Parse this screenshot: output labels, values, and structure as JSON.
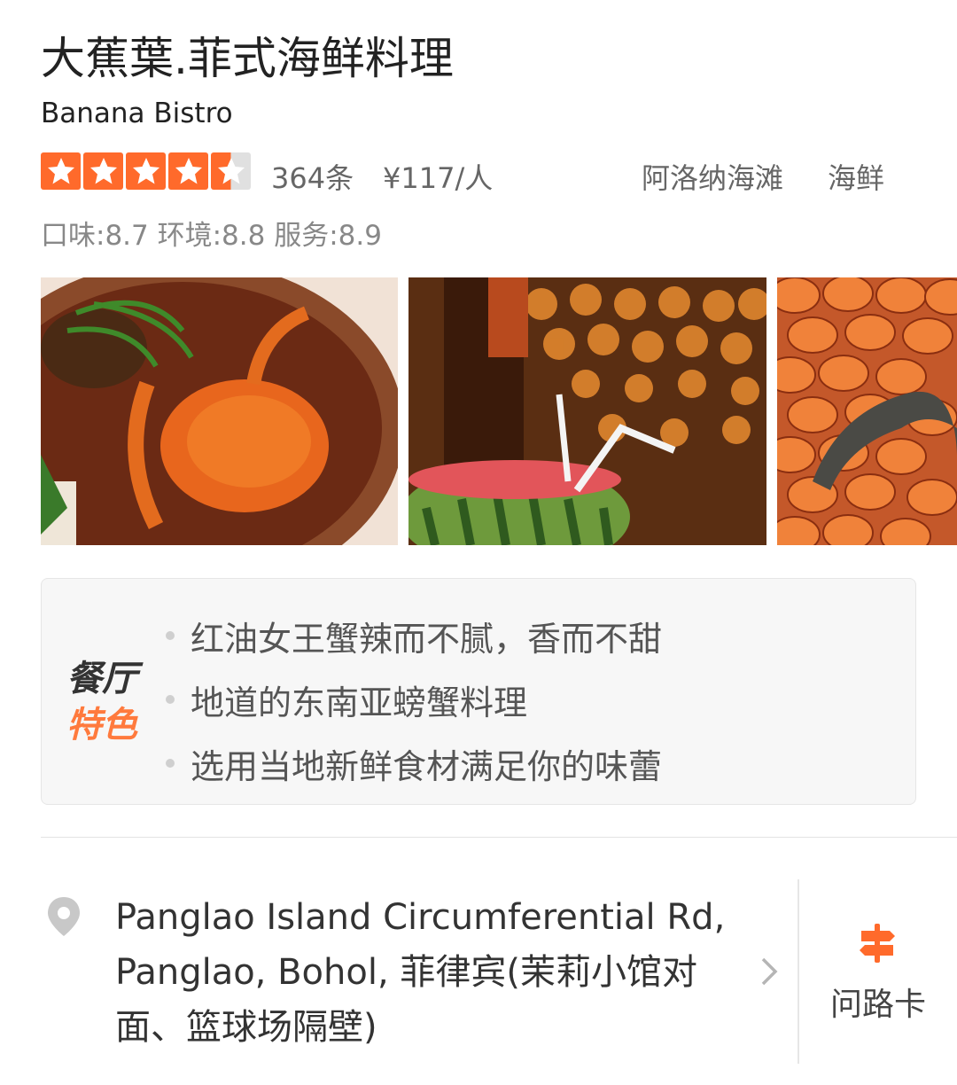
{
  "restaurant": {
    "name": "大蕉葉.菲式海鲜料理",
    "english_name": "Banana Bistro",
    "rating": 4.5,
    "rating_max": 5,
    "review_count": "364条",
    "price": "¥117/人",
    "area": "阿洛纳海滩",
    "category": "海鲜",
    "scores": "口味:8.7 环境:8.8 服务:8.9"
  },
  "photos": [
    {
      "subject": "crab-dish"
    },
    {
      "subject": "watermelon-drink"
    },
    {
      "subject": "crab-shell-wall"
    }
  ],
  "features": {
    "label_line1": "餐厅",
    "label_line2": "特色",
    "items": [
      "红油女王蟹辣而不腻，香而不甜",
      "地道的东南亚螃蟹料理",
      "选用当地新鲜食材满足你的味蕾"
    ]
  },
  "location": {
    "address": "Panglao Island Circumferential Rd, Panglao, Bohol, 菲律宾(茉莉小馆对面、篮球场隔壁)",
    "route_card_label": "问路卡",
    "pin_icon": "location-pin-icon",
    "route_icon": "signpost-icon"
  },
  "colors": {
    "star_orange": "#ff6a2b",
    "star_empty": "#e0e0e0",
    "accent": "#ff7a3d"
  }
}
